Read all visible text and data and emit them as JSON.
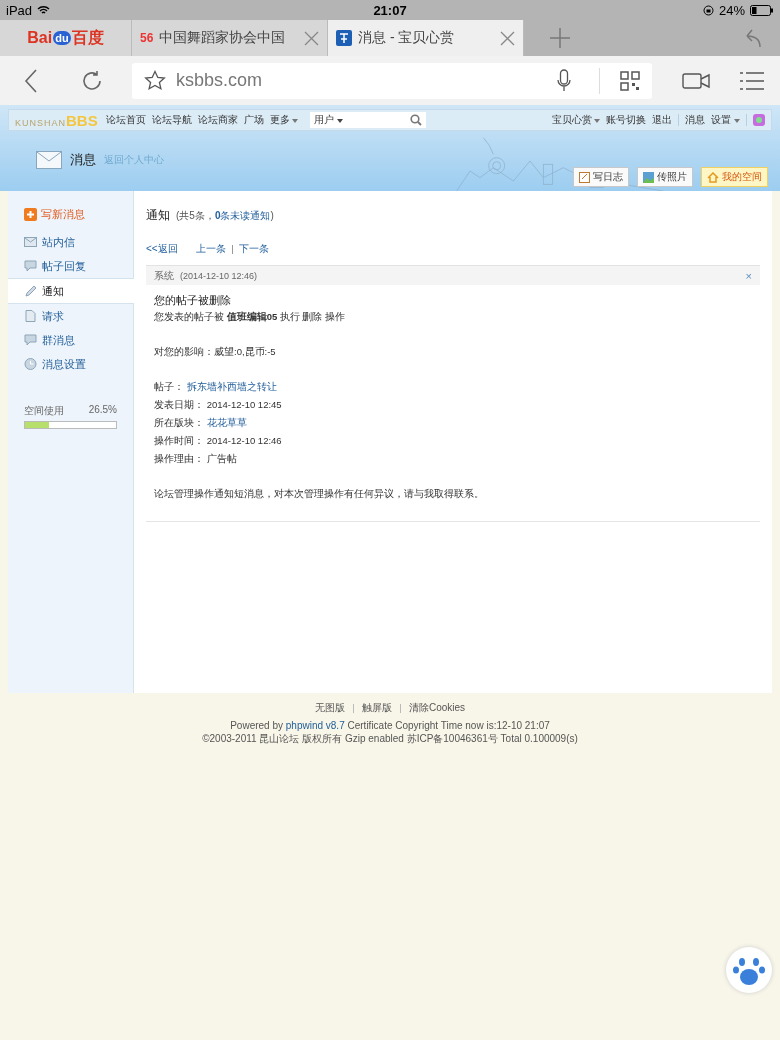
{
  "status_bar": {
    "device": "iPad",
    "time": "21:07",
    "battery": "24%"
  },
  "browser_tabs": [
    {
      "kind": "logo",
      "logo_parts": [
        "Bai",
        "du",
        "百度"
      ],
      "selected": false
    },
    {
      "kind": "page",
      "badge": "56",
      "title": "中国舞蹈家协会中国",
      "selected": false
    },
    {
      "kind": "page",
      "title": "消息 - 宝贝心赏",
      "selected": true
    }
  ],
  "address_bar": {
    "url": "ksbbs.com"
  },
  "forum_nav": {
    "logo": [
      "KUNSHAN",
      "BBS"
    ],
    "links": [
      "论坛首页",
      "论坛导航",
      "论坛商家",
      "广场"
    ],
    "more": "更多",
    "search_scope": "用户",
    "right_links": [
      {
        "label": "宝贝心赏",
        "dropdown": true
      },
      {
        "label": "账号切换",
        "dropdown": false
      },
      {
        "label": "退出",
        "dropdown": false
      },
      {
        "label": "消息",
        "dropdown": false
      },
      {
        "label": "设置",
        "dropdown": true
      }
    ]
  },
  "header": {
    "title": "消息",
    "back_link": "返回个人中心",
    "buttons": [
      {
        "label": "写日志",
        "highlight": false
      },
      {
        "label": "传照片",
        "highlight": false
      },
      {
        "label": "我的空间",
        "highlight": true
      }
    ]
  },
  "sidebar": {
    "compose": "写新消息",
    "items": [
      {
        "label": "站内信",
        "selected": false
      },
      {
        "label": "帖子回复",
        "selected": false
      },
      {
        "label": "通知",
        "selected": true
      },
      {
        "label": "请求",
        "selected": false
      },
      {
        "label": "群消息",
        "selected": false
      },
      {
        "label": "消息设置",
        "selected": false
      }
    ],
    "space": {
      "label": "空间使用",
      "reading": "26.5%",
      "level": 0.265
    }
  },
  "main": {
    "heading": "通知",
    "count": "(共5条，",
    "unread": "**0**条未读通知",
    "count_end": ")",
    "back": "<<返回",
    "prev": "上一条",
    "next": "下一条",
    "message": {
      "sender": "系统",
      "time": "(2014-12-10 12:46)",
      "close": "×",
      "title": "您的帖子被删除",
      "line": "您发表的帖子被 **值班编辑05** 执行 删除 操作",
      "impact": "对您的影响：威望:0,昆币:-5",
      "fields": [
        {
          "label": "帖子：",
          "value": "拆东墙补西墙之转让",
          "kind": "link"
        },
        {
          "label": "发表日期：",
          "value": "2014-12-10 12:45",
          "kind": "text"
        },
        {
          "label": "所在版块：",
          "value": "花花草草",
          "kind": "link"
        },
        {
          "label": "操作时间：",
          "value": "2014-12-10 12:46",
          "kind": "text"
        },
        {
          "label": "操作理由：",
          "value": "广告帖",
          "kind": "text"
        }
      ],
      "note": "论坛管理操作通知短消息，对本次管理操作有任何异议，请与我取得联系。"
    }
  },
  "footer": {
    "links": [
      "无图版",
      "触屏版",
      "清除Cookies"
    ],
    "powered_prefix": "Powered by",
    "powered_link": "phpwind v8.7",
    "powered_suffix": "Certificate Copyright Time now is:12-10 21:07",
    "copyright": "©2003-2011 昆山论坛 版权所有 Gzip enabled 苏ICP备10046361号 Total 0.100009(s)"
  }
}
